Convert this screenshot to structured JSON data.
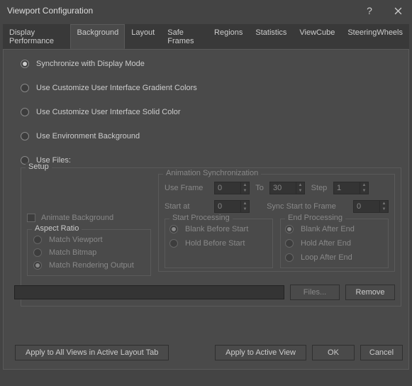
{
  "window": {
    "title": "Viewport Configuration"
  },
  "tabs": [
    {
      "label": "Display Performance"
    },
    {
      "label": "Background"
    },
    {
      "label": "Layout"
    },
    {
      "label": "Safe Frames"
    },
    {
      "label": "Regions"
    },
    {
      "label": "Statistics"
    },
    {
      "label": "ViewCube"
    },
    {
      "label": "SteeringWheels"
    }
  ],
  "bgmode": {
    "sync": "Synchronize with Display Mode",
    "gradient": "Use Customize User Interface Gradient Colors",
    "solid": "Use Customize User Interface Solid Color",
    "env": "Use Environment Background",
    "files": "Use Files:"
  },
  "setup": {
    "label": "Setup",
    "animate_bg": "Animate Background",
    "aspect_label": "Aspect Ratio",
    "aspect": {
      "viewport": "Match Viewport",
      "bitmap": "Match Bitmap",
      "rendering": "Match Rendering Output"
    },
    "anim_label": "Animation Synchronization",
    "use_frame": "Use Frame",
    "use_frame_val": "0",
    "to": "To",
    "to_val": "30",
    "step": "Step",
    "step_val": "1",
    "start_at": "Start at",
    "start_at_val": "0",
    "sync_start": "Sync Start to Frame",
    "sync_start_val": "0",
    "start_proc": "Start Processing",
    "end_proc": "End Processing",
    "blank_before": "Blank Before Start",
    "hold_before": "Hold Before Start",
    "blank_after": "Blank After End",
    "hold_after": "Hold After End",
    "loop_after": "Loop After End",
    "files_btn": "Files...",
    "remove_btn": "Remove"
  },
  "footer": {
    "apply_all": "Apply to All Views in Active Layout Tab",
    "apply_active": "Apply to Active View",
    "ok": "OK",
    "cancel": "Cancel"
  }
}
